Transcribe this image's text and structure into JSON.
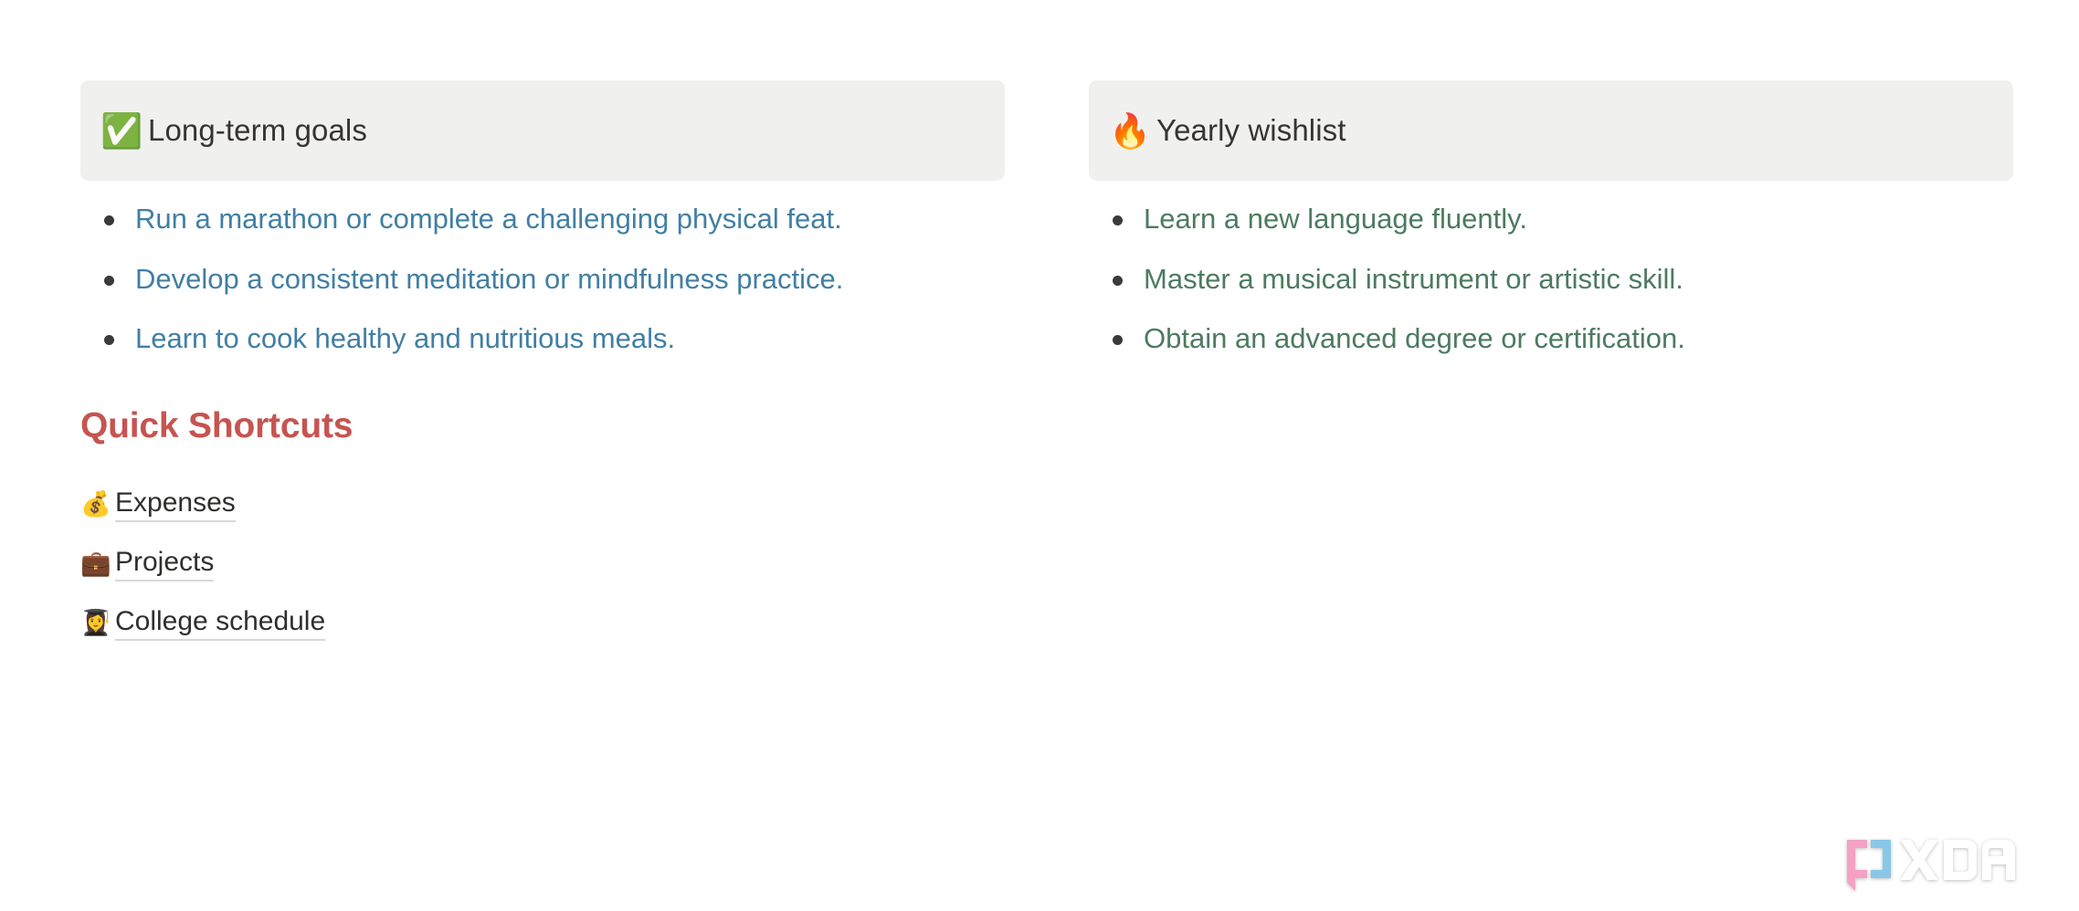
{
  "page": {
    "background_color": "#ffffff"
  },
  "columns": [
    {
      "callout": {
        "emoji": "✅",
        "emoji_name": "white-check-mark-emoji",
        "title": "Long-term goals",
        "background_color": "#f0f0ef"
      },
      "list": {
        "text_color": "#417fa4",
        "items": [
          "Run a marathon or complete a challenging physical feat.",
          "Develop a consistent meditation or mindfulness practice.",
          "Learn to cook healthy and nutritious meals."
        ]
      }
    },
    {
      "callout": {
        "emoji": "🔥",
        "emoji_name": "fire-emoji",
        "title": "Yearly wishlist",
        "background_color": "#f0f0ef"
      },
      "list": {
        "text_color": "#4c7b60",
        "items": [
          "Learn a new language fluently.",
          "Master a musical instrument or artistic skill.",
          "Obtain an advanced degree or certification."
        ]
      }
    }
  ],
  "shortcuts": {
    "heading": "Quick Shortcuts",
    "heading_color": "#c65450",
    "items": [
      {
        "emoji": "💰",
        "emoji_name": "money-bag-emoji",
        "label": "Expenses"
      },
      {
        "emoji": "💼",
        "emoji_name": "briefcase-emoji",
        "label": "Projects"
      },
      {
        "emoji": "👩‍🎓",
        "emoji_name": "woman-student-emoji",
        "label": "College schedule"
      }
    ]
  },
  "watermark": {
    "brand": "XDA",
    "bracket_left_color": "#f49ac1",
    "bracket_right_color": "#7fc3e8",
    "wordmark_color": "#ffffff"
  }
}
